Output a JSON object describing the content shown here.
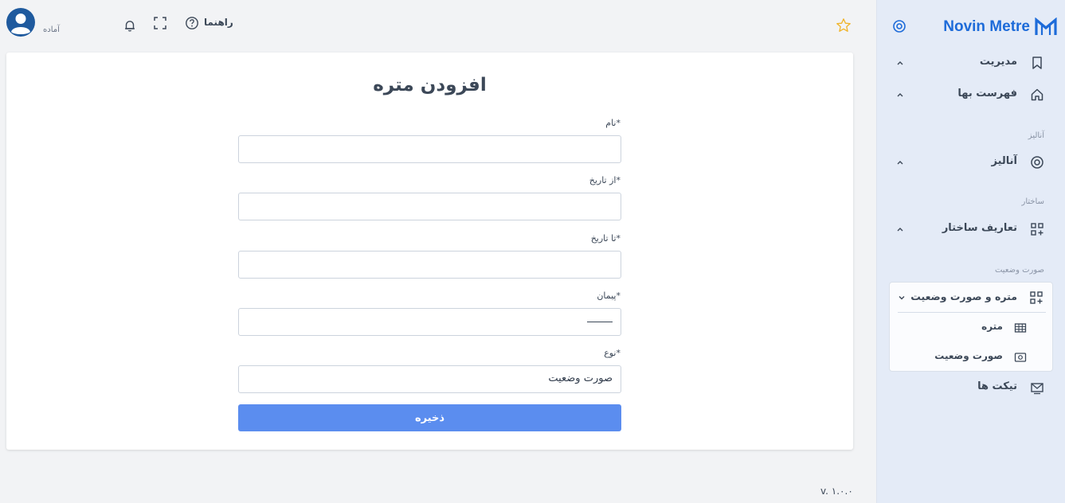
{
  "app": {
    "brand_name": "Novin Metre",
    "version": "v. ۱.۰.۰"
  },
  "topbar": {
    "user_status": "آماده",
    "help_label": "راهنما",
    "icons": [
      "avatar",
      "bell-icon",
      "fullscreen-icon",
      "help-icon",
      "star-icon"
    ]
  },
  "sidebar": {
    "items": [
      {
        "label": "مدیریت",
        "icon": "bookmark-icon"
      },
      {
        "label": "فهرست بها",
        "icon": "home-icon"
      }
    ],
    "section_analysis": "آنالیز",
    "analysis_item": {
      "label": "آنالیز",
      "icon": "target-icon"
    },
    "section_structure": "ساختار",
    "structure_item": {
      "label": "تعاریف ساختار",
      "icon": "grid-plus-icon"
    },
    "section_statement": "صورت وضعیت",
    "statement_group": {
      "label": "متره و صورت وضعیت",
      "icon": "grid-plus-icon",
      "children": [
        {
          "label": "متره",
          "icon": "table-icon"
        },
        {
          "label": "صورت وضعیت",
          "icon": "document-icon"
        }
      ]
    },
    "tickets_item": {
      "label": "تیکت ها",
      "icon": "mail-icon"
    }
  },
  "form": {
    "title": "افزودن متره",
    "name_label": "نام*",
    "name_value": "",
    "from_date_label": "از تاریخ*",
    "from_date_value": "",
    "to_date_label": "تا تاریخ*",
    "to_date_value": "",
    "contract_label": "پیمان*",
    "type_label": "نوع*",
    "type_value": "صورت وضعیت",
    "save_label": "ذخیره"
  },
  "colors": {
    "brand": "#1d6bd9",
    "primary_button": "#5b8def",
    "sidebar_bg": "#e4ebf7",
    "star": "#f0b429"
  }
}
